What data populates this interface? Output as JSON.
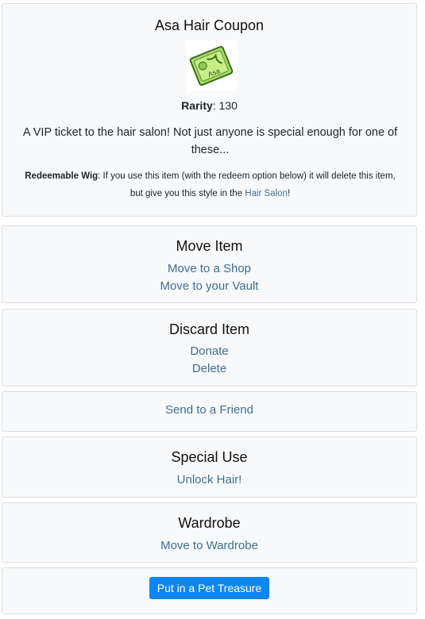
{
  "item": {
    "name": "Asa Hair Coupon",
    "image_icon": "hair-coupon-ticket-icon",
    "rarity_label": "Rarity",
    "rarity_value": ": 130",
    "description": "A VIP ticket to the hair salon! Not just anyone is special enough for one of these...",
    "wig_label": "Redeemable Wig",
    "wig_text_before": ": If you use this item (with the redeem option below) it will delete this item, but give you this style in the ",
    "wig_link": "Hair Salon",
    "wig_text_after": "!",
    "ticket_text": "Asa"
  },
  "move": {
    "title": "Move Item",
    "shop_link": "Move to a Shop",
    "vault_link": "Move to your Vault"
  },
  "discard": {
    "title": "Discard Item",
    "donate_link": "Donate",
    "delete_link": "Delete"
  },
  "send": {
    "friend_link": "Send to a Friend"
  },
  "special": {
    "title": "Special Use",
    "unlock_link": "Unlock Hair!"
  },
  "wardrobe": {
    "title": "Wardrobe",
    "move_link": "Move to Wardrobe"
  },
  "treasure": {
    "button_label": "Put in a Pet Treasure"
  },
  "colors": {
    "link": "#3e6f95",
    "primary_button": "#0d86f2",
    "card_bg": "#f8f9fa",
    "card_border": "#dcdfe3"
  }
}
